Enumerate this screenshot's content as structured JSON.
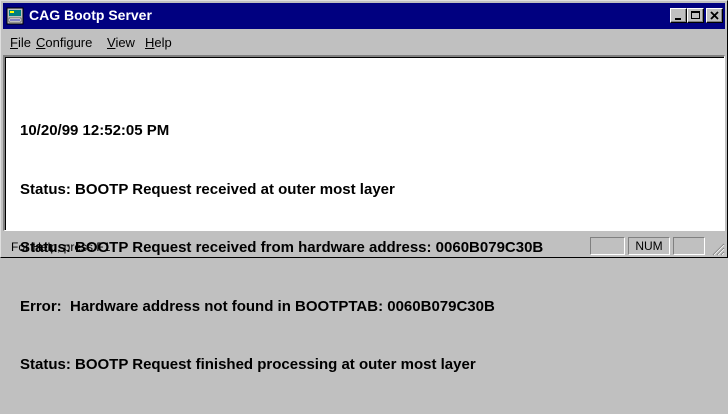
{
  "window": {
    "title": "CAG Bootp Server",
    "icon": "network-server-icon"
  },
  "menu": {
    "items": [
      {
        "label": "File",
        "accel": "F",
        "rest": "ile"
      },
      {
        "label": "Configure",
        "accel": "C",
        "rest": "onfigure"
      },
      {
        "label": "View",
        "accel": "V",
        "rest": "iew"
      },
      {
        "label": "Help",
        "accel": "H",
        "rest": "elp"
      }
    ]
  },
  "log": {
    "lines": [
      "10/20/99 12:52:05 PM",
      "Status: BOOTP Request received at outer most layer",
      "Status: BOOTP Request received from hardware address: 0060B079C30B",
      "Error:  Hardware address not found in BOOTPTAB: 0060B079C30B",
      "Status: BOOTP Request finished processing at outer most layer"
    ]
  },
  "statusbar": {
    "help_text": "For Help, press F1",
    "panes": [
      "",
      "NUM",
      ""
    ]
  },
  "colors": {
    "titlebar": "#000080",
    "face": "#c0c0c0",
    "client": "#ffffff"
  }
}
